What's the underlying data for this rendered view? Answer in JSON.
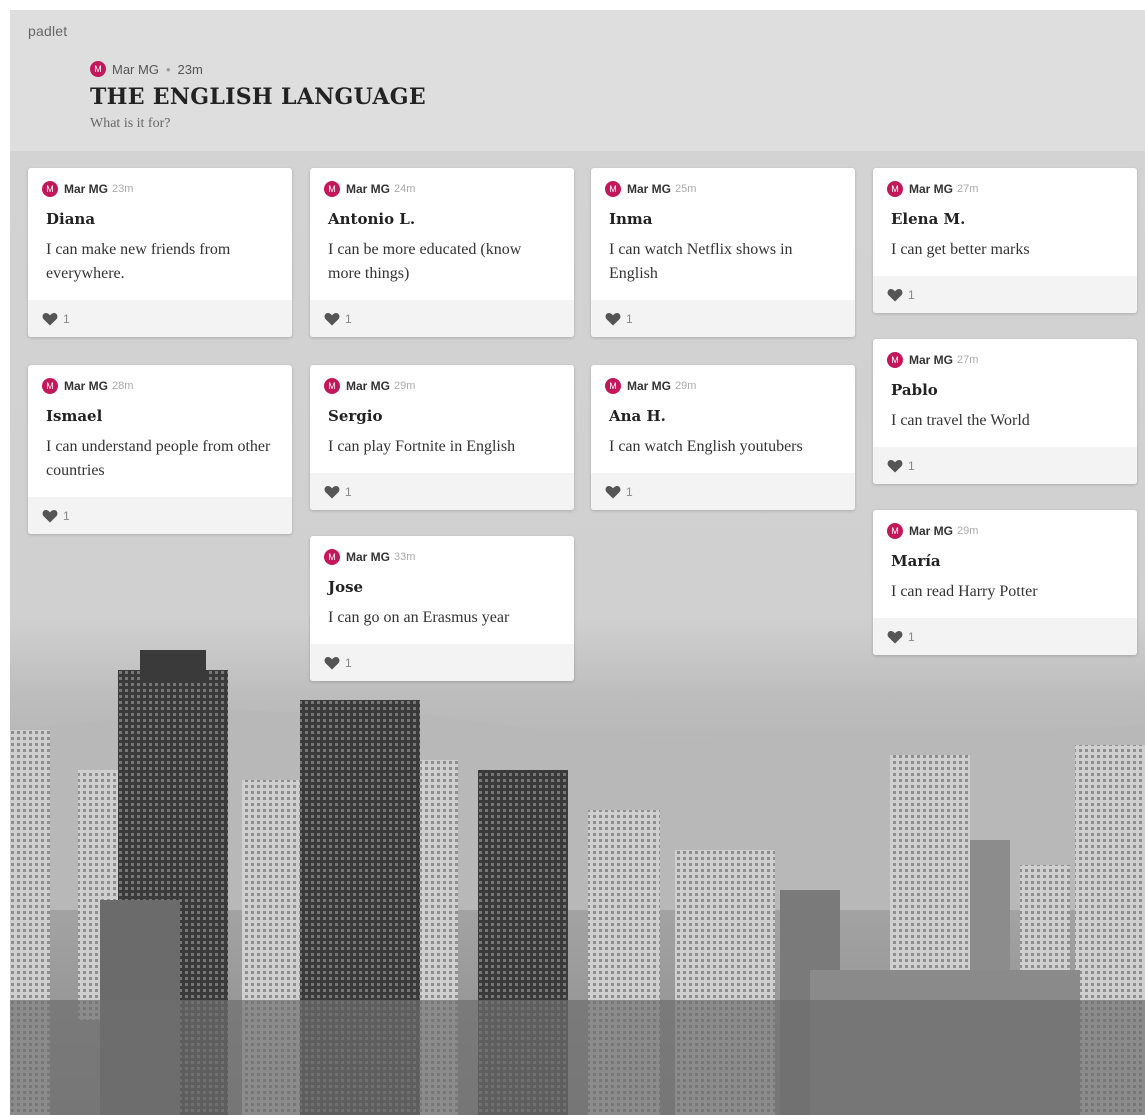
{
  "header": {
    "brand": "padlet",
    "author": "Mar MG",
    "avatar_letter": "M",
    "separator": "•",
    "time": "23m",
    "title": "THE ENGLISH LANGUAGE",
    "subtitle": "What is it for?"
  },
  "colors": {
    "avatar": "#c2185b",
    "header_bg": "#dedede",
    "card_footer": "#f3f3f3"
  },
  "posts": [
    {
      "author": "Mar MG",
      "avatar_letter": "M",
      "time": "23m",
      "title": "Diana",
      "body": "I can make new friends from everywhere.",
      "likes": "1"
    },
    {
      "author": "Mar MG",
      "avatar_letter": "M",
      "time": "24m",
      "title": "Antonio L.",
      "body": "I can be more educated (know more things)",
      "likes": "1"
    },
    {
      "author": "Mar MG",
      "avatar_letter": "M",
      "time": "25m",
      "title": "Inma",
      "body": "I can watch Netflix shows in English",
      "likes": "1"
    },
    {
      "author": "Mar MG",
      "avatar_letter": "M",
      "time": "27m",
      "title": "Elena M.",
      "body": "I can get better marks",
      "likes": "1"
    },
    {
      "author": "Mar MG",
      "avatar_letter": "M",
      "time": "28m",
      "title": "Ismael",
      "body": "I can understand people from other countries",
      "likes": "1"
    },
    {
      "author": "Mar MG",
      "avatar_letter": "M",
      "time": "29m",
      "title": "Sergio",
      "body": "I can play Fortnite in English",
      "likes": "1"
    },
    {
      "author": "Mar MG",
      "avatar_letter": "M",
      "time": "29m",
      "title": "Ana H.",
      "body": "I can watch English youtubers",
      "likes": "1"
    },
    {
      "author": "Mar MG",
      "avatar_letter": "M",
      "time": "27m",
      "title": "Pablo",
      "body": "I can travel the World",
      "likes": "1"
    },
    {
      "author": "Mar MG",
      "avatar_letter": "M",
      "time": "33m",
      "title": "Jose",
      "body": "I can go on an Erasmus year",
      "likes": "1"
    },
    {
      "author": "Mar MG",
      "avatar_letter": "M",
      "time": "29m",
      "title": "María",
      "body": "I can read Harry Potter",
      "likes": "1"
    }
  ]
}
